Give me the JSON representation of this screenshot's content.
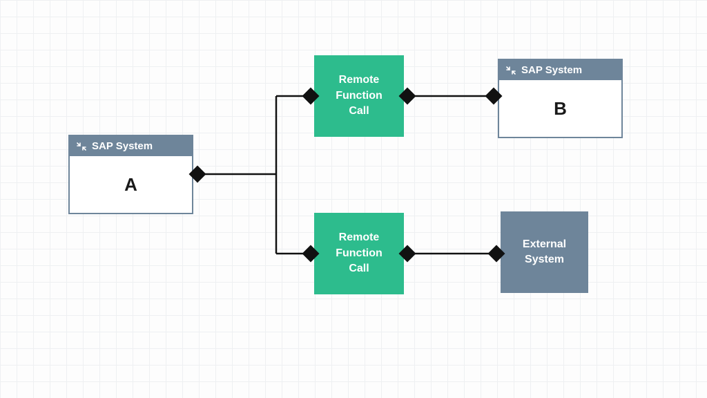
{
  "nodes": {
    "sap_a": {
      "header": "SAP System",
      "body": "A"
    },
    "sap_b": {
      "header": "SAP System",
      "body": "B"
    },
    "rfc1": {
      "label": "Remote\nFunction\nCall"
    },
    "rfc2": {
      "label": "Remote\nFunction\nCall"
    },
    "external": {
      "label": "External\nSystem"
    }
  },
  "colors": {
    "sap_header": "#6e859a",
    "rfc": "#2dbc8d",
    "external_bg": "#6e859a",
    "line": "#111111"
  }
}
